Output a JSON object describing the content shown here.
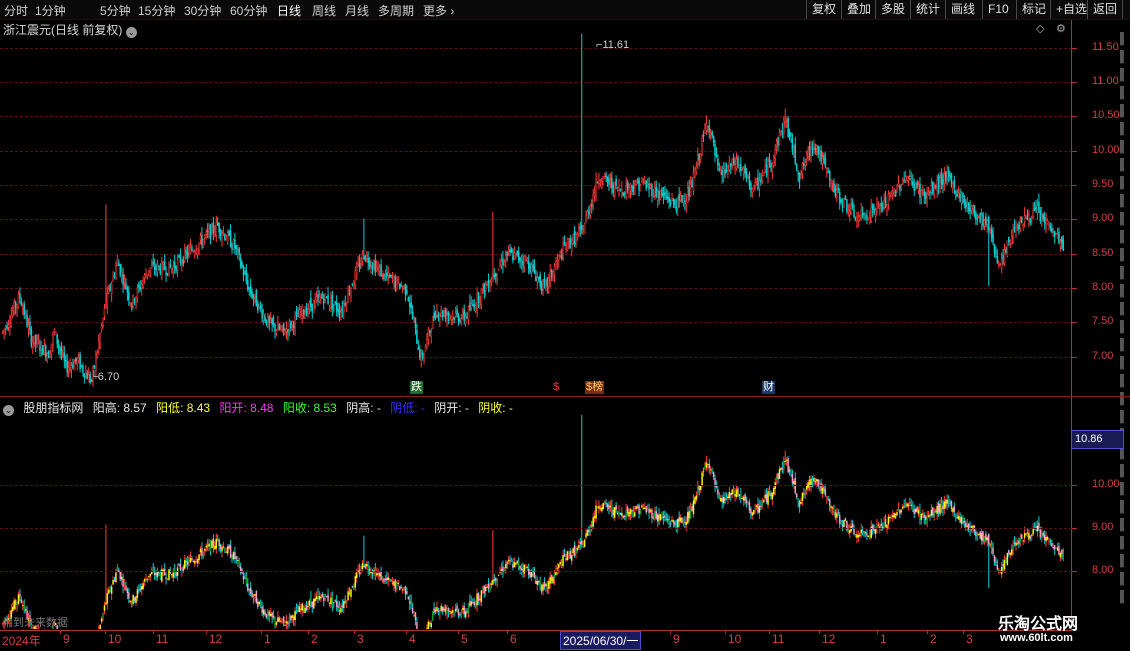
{
  "toolbar": {
    "periods": [
      "分时",
      "1分钟",
      "5分钟",
      "15分钟",
      "30分钟",
      "60分钟",
      "日线",
      "周线",
      "月线",
      "多周期",
      "更多"
    ],
    "active": "日线",
    "right_buttons": [
      "复权",
      "叠加",
      "多股",
      "统计",
      "画线",
      "F10",
      "标记",
      "+自选",
      "返回"
    ]
  },
  "main_pane": {
    "title": "浙江震元(日线 前复权)",
    "y_ticks": [
      "11.50",
      "11.00",
      "10.50",
      "10.00",
      "9.50",
      "9.00",
      "8.50",
      "8.00",
      "7.50",
      "7.00"
    ],
    "high_label": "11.61",
    "low_label": "6.70",
    "markers": [
      {
        "text": "跌",
        "color": "#ffffff",
        "bg": "#1f6b2a"
      },
      {
        "text": "$",
        "color": "#ff3030",
        "bg": "#000000"
      },
      {
        "text": "$榜",
        "color": "#ffcc66",
        "bg": "#7a2a10"
      },
      {
        "text": "财",
        "color": "#ffffff",
        "bg": "#1a3a6a"
      }
    ]
  },
  "indicator_pane": {
    "name": "股朋指标网",
    "fields": [
      {
        "label": "阳高: 8.57",
        "color": "#e8e8e8"
      },
      {
        "label": "阳低: 8.43",
        "color": "#ffff33"
      },
      {
        "label": "阳开: 8.48",
        "color": "#ff33ff"
      },
      {
        "label": "阳收: 8.53",
        "color": "#33ff33"
      },
      {
        "label": "阴高: -",
        "color": "#e8e8e8"
      },
      {
        "label": "阴低: -",
        "color": "#3333ff"
      },
      {
        "label": "阴开: -",
        "color": "#e8e8e8"
      },
      {
        "label": "阴收: -",
        "color": "#ffff33"
      }
    ],
    "y_ticks": [
      "10.00",
      "9.00",
      "8.00"
    ],
    "cursor_value": "10.86"
  },
  "x_axis": {
    "labels": [
      "2024年",
      "9",
      "10",
      "11",
      "12",
      "1",
      "2",
      "3",
      "4",
      "5",
      "6",
      "2025/06/30/一",
      "9",
      "10",
      "11",
      "12",
      "1",
      "2",
      "3"
    ],
    "future_note": "用到未来数据"
  },
  "watermark": {
    "line1": "乐淘公式网",
    "line2": "www.60lt.com"
  },
  "colors": {
    "up": "#ff3a3a",
    "down": "#00d0d0",
    "yang_fill": "#ffff00",
    "yin_fill": "#ff9ec8",
    "green": "#0f9b2a"
  },
  "chart_data": {
    "type": "candlestick",
    "title": "浙江震元(日线 前复权)",
    "ylim": [
      6.5,
      11.8
    ],
    "ylim_indicator": [
      7.3,
      11.2
    ],
    "pivots": [
      [
        0,
        7.4
      ],
      [
        12,
        7.9
      ],
      [
        20,
        7.3
      ],
      [
        32,
        7.1
      ],
      [
        36,
        7.4
      ],
      [
        44,
        6.9
      ],
      [
        52,
        7.0
      ],
      [
        62,
        6.7
      ],
      [
        72,
        7.8
      ],
      [
        80,
        8.4
      ],
      [
        90,
        7.8
      ],
      [
        102,
        8.3
      ],
      [
        118,
        8.3
      ],
      [
        134,
        8.6
      ],
      [
        150,
        8.9
      ],
      [
        162,
        8.6
      ],
      [
        172,
        8.0
      ],
      [
        186,
        7.5
      ],
      [
        196,
        7.4
      ],
      [
        210,
        7.7
      ],
      [
        224,
        7.9
      ],
      [
        236,
        7.7
      ],
      [
        252,
        8.5
      ],
      [
        266,
        8.2
      ],
      [
        282,
        8.0
      ],
      [
        292,
        7.0
      ],
      [
        302,
        7.7
      ],
      [
        322,
        7.6
      ],
      [
        342,
        8.2
      ],
      [
        352,
        8.5
      ],
      [
        366,
        8.4
      ],
      [
        378,
        8.0
      ],
      [
        392,
        8.6
      ],
      [
        404,
        8.8
      ],
      [
        410,
        9.2
      ],
      [
        416,
        9.6
      ],
      [
        430,
        9.4
      ],
      [
        446,
        9.5
      ],
      [
        470,
        9.2
      ],
      [
        480,
        9.4
      ],
      [
        492,
        10.4
      ],
      [
        500,
        9.6
      ],
      [
        512,
        9.8
      ],
      [
        524,
        9.4
      ],
      [
        536,
        9.8
      ],
      [
        546,
        10.4
      ],
      [
        556,
        9.6
      ],
      [
        566,
        10.1
      ],
      [
        580,
        9.4
      ],
      [
        596,
        9.0
      ],
      [
        616,
        9.2
      ],
      [
        630,
        9.6
      ],
      [
        644,
        9.3
      ],
      [
        658,
        9.6
      ],
      [
        672,
        9.2
      ],
      [
        688,
        8.9
      ],
      [
        696,
        8.3
      ],
      [
        706,
        8.9
      ],
      [
        722,
        9.1
      ],
      [
        740,
        8.6
      ]
    ]
  }
}
